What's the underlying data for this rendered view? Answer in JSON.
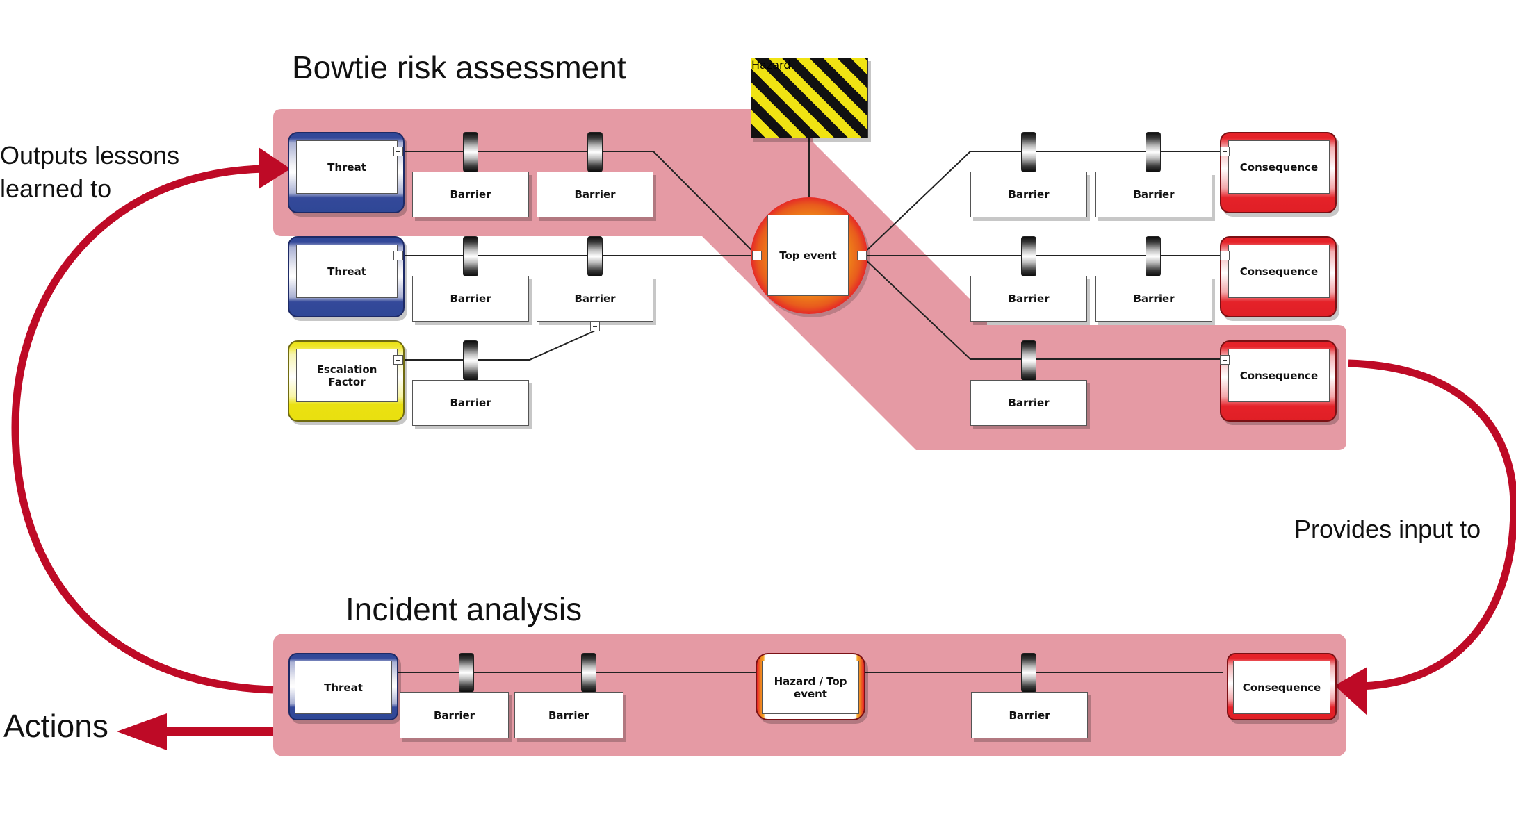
{
  "titles": {
    "bowtie": "Bowtie risk assessment",
    "incident": "Incident analysis"
  },
  "annotations": {
    "outputs_line1": "Outputs lessons",
    "outputs_line2": "learned to",
    "provides": "Provides input to",
    "actions": "Actions"
  },
  "colors": {
    "highlight_band": "#e59aa4",
    "arrow": "#be0a26",
    "threat": "#2f4796",
    "escalation": "#eae112",
    "consequence": "#e52229",
    "hazard_stripe_yellow": "#f0e313",
    "hazard_stripe_black": "#111111"
  },
  "bowtie": {
    "hazard": "Hazard",
    "top_event": "Top event",
    "left_rows": [
      {
        "source_type": "threat",
        "source": "Threat",
        "barriers": [
          "Barrier",
          "Barrier"
        ]
      },
      {
        "source_type": "threat",
        "source": "Threat",
        "barriers": [
          "Barrier",
          "Barrier"
        ]
      },
      {
        "source_type": "escalation",
        "source": "Escalation Factor",
        "barriers": [
          "Barrier"
        ]
      }
    ],
    "right_rows": [
      {
        "barriers": [
          "Barrier",
          "Barrier"
        ],
        "consequence": "Consequence"
      },
      {
        "barriers": [
          "Barrier",
          "Barrier"
        ],
        "consequence": "Consequence"
      },
      {
        "barriers": [
          "Barrier"
        ],
        "consequence": "Consequence"
      }
    ]
  },
  "incident": {
    "threat": "Threat",
    "barriers_left": [
      "Barrier",
      "Barrier"
    ],
    "hazard_top_event": "Hazard / Top event",
    "barriers_right": [
      "Barrier"
    ],
    "consequence": "Consequence"
  }
}
